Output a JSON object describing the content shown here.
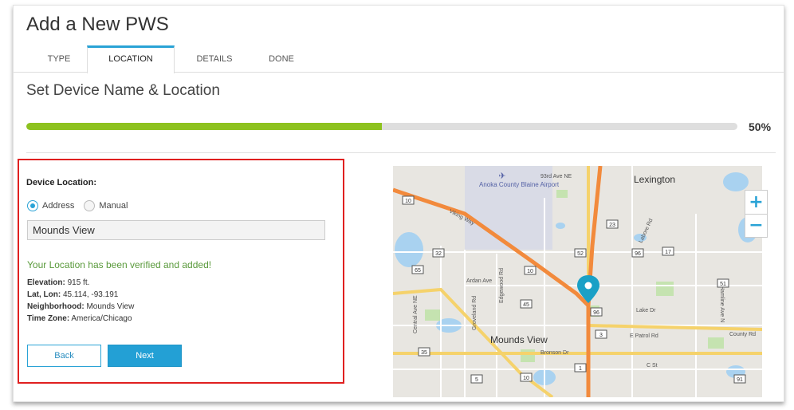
{
  "page_title": "Add a New PWS",
  "tabs": [
    {
      "label": "TYPE"
    },
    {
      "label": "LOCATION"
    },
    {
      "label": "DETAILS"
    },
    {
      "label": "DONE"
    }
  ],
  "section_title": "Set Device Name & Location",
  "progress": {
    "label": "50%",
    "value_percent": 50,
    "color": "#8dc21f"
  },
  "device_location": {
    "label": "Device Location:",
    "options": [
      {
        "label": "Address",
        "selected": true
      },
      {
        "label": "Manual",
        "selected": false
      }
    ],
    "address_value": "Mounds View",
    "verified_message": "Your Location has been verified and added!",
    "details": {
      "elevation_label": "Elevation:",
      "elevation_value": "915 ft.",
      "latlon_label": "Lat, Lon:",
      "latlon_value": "45.114, -93.191",
      "neighborhood_label": "Neighborhood:",
      "neighborhood_value": "Mounds View",
      "timezone_label": "Time Zone:",
      "timezone_value": "America/Chicago"
    }
  },
  "buttons": {
    "back": "Back",
    "next": "Next"
  },
  "map": {
    "place_labels": {
      "lexington": "Lexington",
      "airport": "Anoka County Blaine Airport",
      "mounds_view": "Mounds View",
      "road_93rd": "93rd Ave NE",
      "vagabond": "Viking Way",
      "ardan": "Ardan Ave",
      "central": "Central Ave NE",
      "groveland": "Groveland Rd",
      "edgewood": "Edgewood Rd",
      "bronson": "Bronson Dr",
      "lake": "Lake Dr",
      "epatrol": "E Patrol Rd",
      "county": "County Rd",
      "cst": "C St",
      "hamline": "Hamline Ave N",
      "labore": "Labore Rd"
    },
    "route_shields": [
      "10",
      "23",
      "17",
      "32",
      "51",
      "65",
      "45",
      "10",
      "52",
      "96",
      "35",
      "5",
      "10",
      "1",
      "96",
      "3",
      "91"
    ],
    "zoom_in": "+",
    "zoom_out": "−",
    "marker_color": "#1aa0c6"
  }
}
